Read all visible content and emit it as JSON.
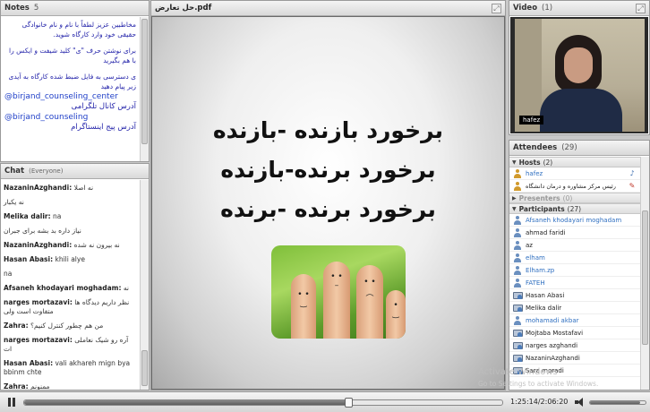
{
  "notes": {
    "title": "Notes",
    "count": "5",
    "paragraphs": [
      "مخاطبین عزیز لطفاً با نام و نام خانوادگی حقیقی خود وارد کارگاه شوید.",
      "برای نوشتن حرف \"ی\" کلید شیفت و ایکس را با هم بگیرید",
      "ی دسترسی به فایل ضبط شده کارگاه به آیدی زیر پیام دهید"
    ],
    "handle1": "@birjand_counseling_center",
    "label1": "آدرس کانال تلگرامی",
    "handle2": "@birjand_counseling",
    "label2": "آدرس پیج اینستاگرام"
  },
  "chat": {
    "title": "Chat",
    "scope": "(Everyone)",
    "messages": [
      {
        "name": "NazaninAzghandi:",
        "text": "نه اصلا"
      },
      {
        "name": "",
        "text": "نه یکبار"
      },
      {
        "name": "Melika dalir:",
        "text": "na"
      },
      {
        "name": "",
        "text": "نیاز داره بد بشه برای جبران"
      },
      {
        "name": "NazaninAzghandi:",
        "text": "نه بیرون نه شده"
      },
      {
        "name": "Hasan Abasi:",
        "text": "khili alye"
      },
      {
        "name": "",
        "text": "na"
      },
      {
        "name": "Afsaneh khodayari moghadam:",
        "text": "نه"
      },
      {
        "name": "narges mortazavi:",
        "text": "نظر داریم دیدگاه ها متفاوت است ولی"
      },
      {
        "name": "Zahra:",
        "text": "من هم چطور کنترل کنیم؟"
      },
      {
        "name": "narges mortazavi:",
        "text": "آره رو شیک نعاملی ات"
      },
      {
        "name": "Hasan Abasi:",
        "text": "vali akhareh mign bya  bbinm chte"
      },
      {
        "name": "Zahra:",
        "text": "ممنونم"
      }
    ]
  },
  "share": {
    "filename": "حل تعارض.pdf",
    "lines": [
      "برخورد بازنده -بازنده",
      "برخورد برنده-بازنده",
      "برخورد برنده -برنده"
    ]
  },
  "video": {
    "title": "Video",
    "count": "(1)",
    "name": "hafez"
  },
  "attendees": {
    "title": "Attendees",
    "count": "(29)",
    "hosts_label": "Hosts",
    "hosts_count": "(2)",
    "hosts": [
      {
        "name": "hafez",
        "color": "blue"
      },
      {
        "name": "رئیس مرکز مشاوره و درمان دانشگاه",
        "color": "normal"
      }
    ],
    "presenters_label": "Presenters",
    "presenters_count": "(0)",
    "participants_label": "Participants",
    "participants_count": "(27)",
    "participants": [
      {
        "name": "Afsaneh khodayari moghadam",
        "color": "blue"
      },
      {
        "name": "ahmad faridi",
        "color": "normal"
      },
      {
        "name": "az",
        "color": "normal"
      },
      {
        "name": "elham",
        "color": "blue"
      },
      {
        "name": "Elham.zp",
        "color": "blue"
      },
      {
        "name": "FATEH",
        "color": "blue"
      },
      {
        "name": "Hasan Abasi",
        "color": "normal"
      },
      {
        "name": "Melika dalir",
        "color": "normal"
      },
      {
        "name": "mohamadi akbar",
        "color": "blue"
      },
      {
        "name": "Mojtaba Mostafavi",
        "color": "normal"
      },
      {
        "name": "narges azghandi",
        "color": "normal"
      },
      {
        "name": "NazaninAzghandi",
        "color": "normal"
      },
      {
        "name": "Sara moradi",
        "color": "normal"
      }
    ],
    "watermark1": "Activate Windows",
    "watermark2": "Go to Settings to activate Windows."
  },
  "playback": {
    "time": "1:25:14/2:06:20",
    "progress": 0.68,
    "volume": 0.9
  }
}
